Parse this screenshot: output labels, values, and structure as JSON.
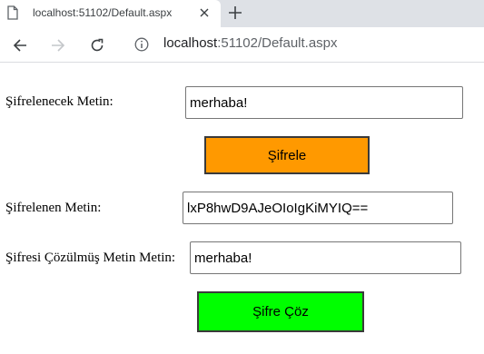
{
  "browser": {
    "tab_title": "localhost:51102/Default.aspx",
    "url_host": "localhost",
    "url_path": ":51102/Default.aspx"
  },
  "form": {
    "plain_label": "Şifrelenecek Metin:",
    "plain_value": "merhaba!",
    "encrypt_button": "Şifrele",
    "encrypted_label": "Şifrelenen Metin:",
    "encrypted_value": "lxP8hwD9AJeOIoIgKiMYIQ==",
    "decrypted_label": "Şifresi Çözülmüş Metin Metin:",
    "decrypted_value": "merhaba!",
    "decrypt_button": "Şifre Çöz"
  },
  "colors": {
    "encrypt_button_bg": "#ff9900",
    "decrypt_button_bg": "#00ff00"
  },
  "icons": {
    "tab": "page-icon",
    "close": "close-icon",
    "new_tab": "plus-icon",
    "back": "back-arrow-icon",
    "forward": "forward-arrow-icon",
    "reload": "reload-icon",
    "info": "info-icon"
  }
}
